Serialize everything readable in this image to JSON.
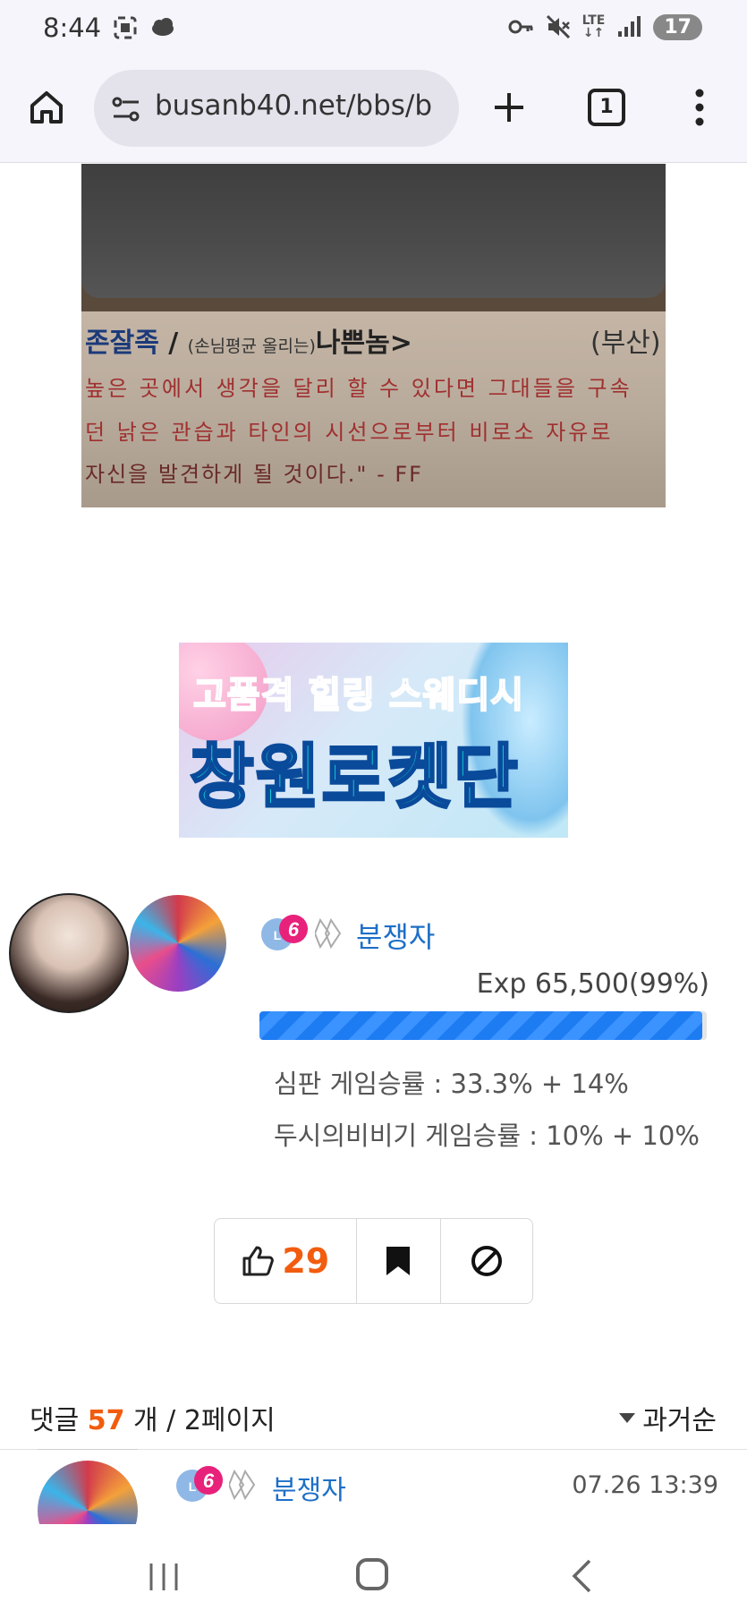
{
  "status_bar": {
    "time": "8:44",
    "network": "LTE",
    "battery": "17",
    "icons": [
      "screenshot-icon",
      "cloud-icon",
      "key-icon",
      "mute-icon",
      "signal-icon",
      "battery-icon"
    ]
  },
  "browser": {
    "url": "busanb40.net/bbs/b",
    "tab_count": "1",
    "icons": [
      "home-icon",
      "site-settings-icon",
      "new-tab-icon",
      "tabs-icon",
      "more-menu-icon"
    ]
  },
  "post_image": {
    "line1_blue": "존잘족",
    "line1_slash": " / ",
    "line1_small": "(손님평균 올리는)",
    "line1_dark": "나쁜놈>",
    "line1_right": "(부산)",
    "line2": "높은 곳에서 생각을 달리 할 수 있다면 그대들을 구속",
    "line3": "던 낡은 관습과 타인의 시선으로부터 비로소 자유로",
    "line4": "자신을 발견하게 될 것이다.\" - FF"
  },
  "ad_banner": {
    "line1": "고품격 힐링 스웨디시",
    "line2": "창원로켓단"
  },
  "author": {
    "level": "6",
    "name": "분쟁자",
    "exp_label": "Exp 65,500(99%)",
    "exp_fraction": 0.99,
    "stat1": "심판 게임승률 : 33.3% + 14%",
    "stat2": "두시의비비기 게임승률 : 10% + 10%"
  },
  "actions": {
    "like_count": "29",
    "accent_color": "#f25c0e"
  },
  "comments": {
    "label_prefix": "댓글 ",
    "count": "57",
    "label_suffix": " 개 / 2페이지",
    "sort_label": "과거순",
    "first": {
      "level": "6",
      "name": "분쟁자",
      "time": "07.26 13:39"
    }
  },
  "nav_bar": {
    "icons": [
      "recent-apps-icon",
      "home-button-icon",
      "back-icon"
    ]
  }
}
